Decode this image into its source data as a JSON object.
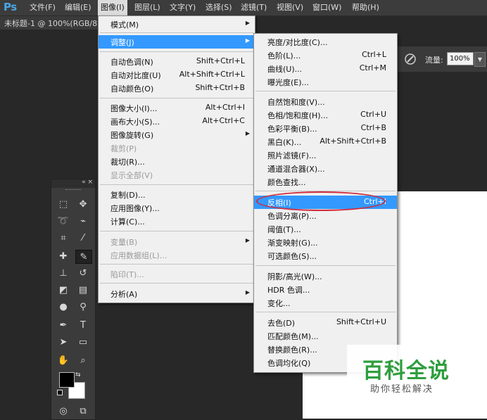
{
  "app": {
    "logo": "Ps"
  },
  "menubar": [
    {
      "label": "文件(F)"
    },
    {
      "label": "编辑(E)"
    },
    {
      "label": "图像(I)"
    },
    {
      "label": "图层(L)"
    },
    {
      "label": "文字(Y)"
    },
    {
      "label": "选择(S)"
    },
    {
      "label": "滤镜(T)"
    },
    {
      "label": "视图(V)"
    },
    {
      "label": "窗口(W)"
    },
    {
      "label": "帮助(H)"
    }
  ],
  "document_tab": "未标题-1 @ 100%(RGB/8)",
  "options_bar": {
    "flow_label": "流量:",
    "flow_value": "100%",
    "brush_icon": "airbrush-icon",
    "dropdown_icon": "chevron-down-icon"
  },
  "toolbox": {
    "collapse_icon": "«",
    "close_icon": "×"
  },
  "image_menu": {
    "items": [
      {
        "label": "模式(M)",
        "shortcut": "",
        "submenu": true,
        "disabled": false
      },
      {
        "label": "调整(J)",
        "shortcut": "",
        "submenu": true,
        "disabled": false,
        "highlighted": true
      },
      {
        "label": "自动色调(N)",
        "shortcut": "Shift+Ctrl+L"
      },
      {
        "label": "自动对比度(U)",
        "shortcut": "Alt+Shift+Ctrl+L"
      },
      {
        "label": "自动颜色(O)",
        "shortcut": "Shift+Ctrl+B"
      },
      {
        "label": "图像大小(I)...",
        "shortcut": "Alt+Ctrl+I"
      },
      {
        "label": "画布大小(S)...",
        "shortcut": "Alt+Ctrl+C"
      },
      {
        "label": "图像旋转(G)",
        "shortcut": "",
        "submenu": true
      },
      {
        "label": "裁剪(P)",
        "shortcut": "",
        "disabled": true
      },
      {
        "label": "裁切(R)...",
        "shortcut": ""
      },
      {
        "label": "显示全部(V)",
        "shortcut": "",
        "disabled": true
      },
      {
        "label": "复制(D)...",
        "shortcut": ""
      },
      {
        "label": "应用图像(Y)...",
        "shortcut": ""
      },
      {
        "label": "计算(C)...",
        "shortcut": ""
      },
      {
        "label": "变量(B)",
        "shortcut": "",
        "submenu": true,
        "disabled": true
      },
      {
        "label": "应用数据组(L)...",
        "shortcut": "",
        "disabled": true
      },
      {
        "label": "陷印(T)...",
        "shortcut": "",
        "disabled": true
      },
      {
        "label": "分析(A)",
        "shortcut": "",
        "submenu": true
      }
    ]
  },
  "adjust_menu": {
    "items": [
      {
        "label": "亮度/对比度(C)...",
        "shortcut": ""
      },
      {
        "label": "色阶(L)...",
        "shortcut": "Ctrl+L"
      },
      {
        "label": "曲线(U)...",
        "shortcut": "Ctrl+M"
      },
      {
        "label": "曝光度(E)...",
        "shortcut": ""
      },
      {
        "label": "自然饱和度(V)...",
        "shortcut": ""
      },
      {
        "label": "色相/饱和度(H)...",
        "shortcut": "Ctrl+U"
      },
      {
        "label": "色彩平衡(B)...",
        "shortcut": "Ctrl+B"
      },
      {
        "label": "黑白(K)...",
        "shortcut": "Alt+Shift+Ctrl+B"
      },
      {
        "label": "照片滤镜(F)...",
        "shortcut": ""
      },
      {
        "label": "通道混合器(X)...",
        "shortcut": ""
      },
      {
        "label": "颜色查找...",
        "shortcut": ""
      },
      {
        "label": "反相(I)",
        "shortcut": "Ctrl+I",
        "highlighted": true
      },
      {
        "label": "色调分离(P)...",
        "shortcut": ""
      },
      {
        "label": "阈值(T)...",
        "shortcut": ""
      },
      {
        "label": "渐变映射(G)...",
        "shortcut": ""
      },
      {
        "label": "可选颜色(S)...",
        "shortcut": ""
      },
      {
        "label": "阴影/高光(W)...",
        "shortcut": ""
      },
      {
        "label": "HDR 色调...",
        "shortcut": ""
      },
      {
        "label": "变化...",
        "shortcut": ""
      },
      {
        "label": "去色(D)",
        "shortcut": "Shift+Ctrl+U"
      },
      {
        "label": "匹配颜色(M)...",
        "shortcut": ""
      },
      {
        "label": "替换颜色(R)...",
        "shortcut": ""
      },
      {
        "label": "色调均化(Q)",
        "shortcut": ""
      }
    ]
  },
  "watermark": {
    "title": "百科全说",
    "subtitle": "助你轻松解决"
  },
  "colors": {
    "highlight": "#3399ff",
    "annotation_circle": "#d12a3a",
    "watermark_green": "#2e9e3e"
  }
}
